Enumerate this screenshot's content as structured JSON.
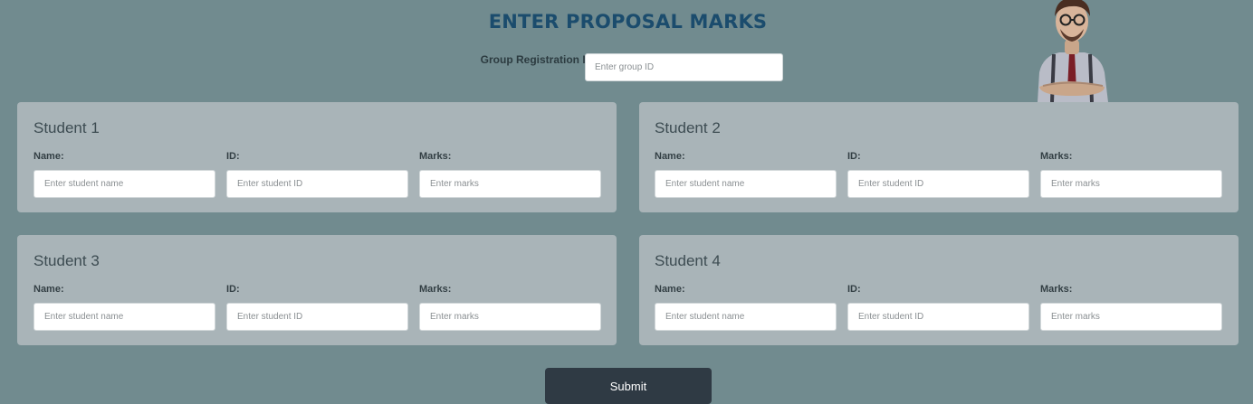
{
  "header": {
    "title": "ENTER PROPOSAL MARKS",
    "group_label": "Group Registration ID:",
    "group_placeholder": "Enter group ID",
    "group_value": ""
  },
  "students": [
    {
      "title": "Student 1",
      "name_label": "Name:",
      "id_label": "ID:",
      "marks_label": "Marks:",
      "name_placeholder": "Enter student name",
      "id_placeholder": "Enter student ID",
      "marks_placeholder": "Enter marks"
    },
    {
      "title": "Student 2",
      "name_label": "Name:",
      "id_label": "ID:",
      "marks_label": "Marks:",
      "name_placeholder": "Enter student name",
      "id_placeholder": "Enter student ID",
      "marks_placeholder": "Enter marks"
    },
    {
      "title": "Student 3",
      "name_label": "Name:",
      "id_label": "ID:",
      "marks_label": "Marks:",
      "name_placeholder": "Enter student name",
      "id_placeholder": "Enter student ID",
      "marks_placeholder": "Enter marks"
    },
    {
      "title": "Student 4",
      "name_label": "Name:",
      "id_label": "ID:",
      "marks_label": "Marks:",
      "name_placeholder": "Enter student name",
      "id_placeholder": "Enter student ID",
      "marks_placeholder": "Enter marks"
    }
  ],
  "actions": {
    "submit_label": "Submit"
  },
  "decor": {
    "avatar_icon": "teacher-avatar-illustration"
  },
  "colors": {
    "background": "#718b8f",
    "card": "#a9b4b8",
    "title": "#1b4c6d",
    "submit_bg": "#2f3a44"
  }
}
